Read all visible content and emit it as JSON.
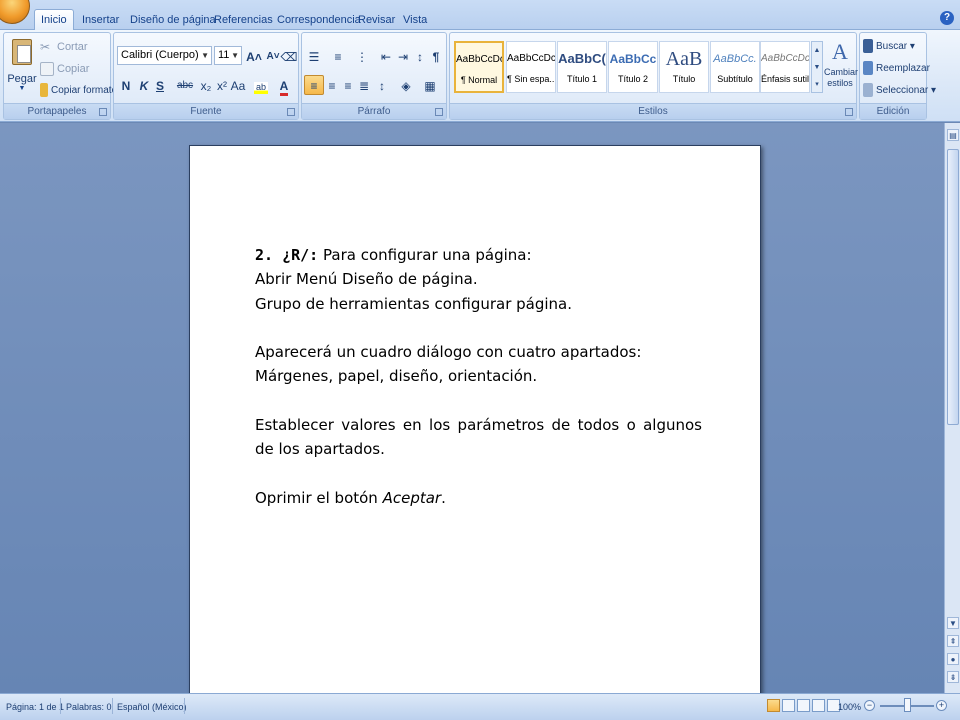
{
  "tabs": [
    "Inicio",
    "Insertar",
    "Diseño de página",
    "Referencias",
    "Correspondencia",
    "Revisar",
    "Vista"
  ],
  "portapapeles": {
    "pegar": "Pegar",
    "cortar": "Cortar",
    "copiar": "Copiar",
    "copiar_formato": "Copiar formato",
    "label": "Portapapeles"
  },
  "fuente": {
    "font": "Calibri (Cuerpo)",
    "size": "11",
    "label": "Fuente",
    "bold": "N",
    "italic": "K",
    "underline": "S",
    "strike": "abc",
    "sub": "x₂",
    "sup": "x²",
    "case": "Aa",
    "grow": "A˄",
    "shrink": "A˅"
  },
  "parrafo": {
    "label": "Párrafo",
    "pilcrow": "¶"
  },
  "estilos": {
    "label": "Estilos",
    "cambiar": "Cambiar estilos",
    "items": [
      {
        "sample": "AaBbCcDc",
        "name": "¶ Normal"
      },
      {
        "sample": "AaBbCcDc",
        "name": "¶ Sin espa..."
      },
      {
        "sample": "AaBbC(",
        "name": "Título 1"
      },
      {
        "sample": "AaBbCc",
        "name": "Título 2"
      },
      {
        "sample": "AaB",
        "name": "Título"
      },
      {
        "sample": "AaBbCc.",
        "name": "Subtítulo"
      },
      {
        "sample": "AaBbCcDc",
        "name": "Énfasis sutil"
      }
    ]
  },
  "edicion": {
    "buscar": "Buscar",
    "reemplazar": "Reemplazar",
    "seleccionar": "Seleccionar",
    "label": "Edición"
  },
  "document": {
    "q_number": "2. ¿R/:",
    "line1": "Para configurar una página:",
    "line2": "Abrir Menú Diseño de página.",
    "line3": "Grupo de herramientas configurar página.",
    "line4": "Aparecerá un cuadro diálogo con cuatro apartados:",
    "line5": "Márgenes, papel, diseño, orientación.",
    "line6": "Establecer valores en los parámetros de todos o algunos de los apartados.",
    "line7_prefix": "Oprimir el botón ",
    "line7_italic": "Aceptar",
    "line7_suffix": "."
  },
  "status": {
    "page": "Página: 1 de 1",
    "words": "Palabras: 0",
    "language": "Español (México)",
    "zoom": "100%"
  },
  "colors": {
    "ribbon": "#dde9f8",
    "tab_text": "#15428b",
    "doc_bg": "#6b88b4"
  }
}
